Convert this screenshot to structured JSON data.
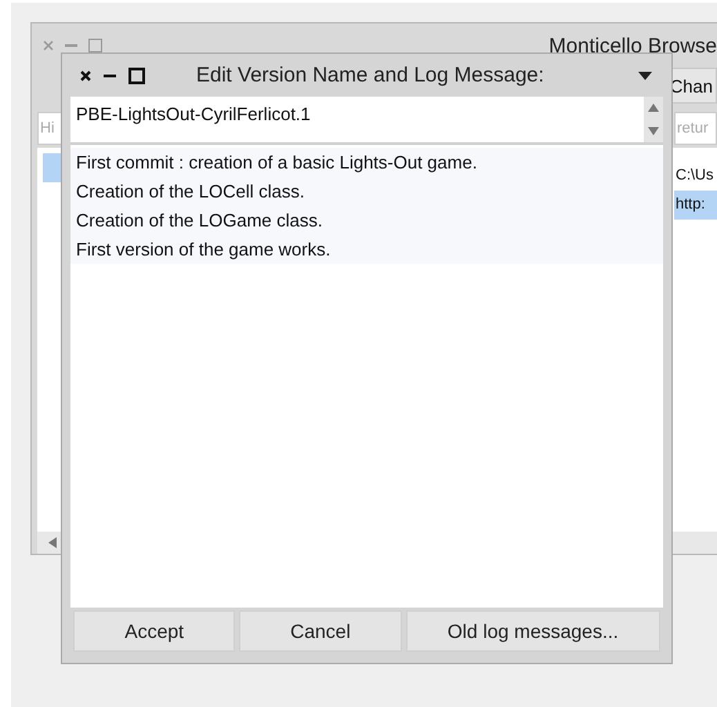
{
  "back_window": {
    "title": "Monticello Browse",
    "toolbar_button": "Chan",
    "search_left": {
      "placeholder": "Hi"
    },
    "search_right": {
      "placeholder": "retur"
    },
    "left_list": [
      {
        "selected": true
      }
    ],
    "right_list": [
      {
        "label": "C:\\Us",
        "selected": false
      },
      {
        "label": "http:",
        "selected": true
      }
    ]
  },
  "dialog": {
    "title": "Edit Version Name and Log Message:",
    "version_name": "PBE-LightsOut-CyrilFerlicot.1",
    "log_lines": [
      "First commit : creation of a basic Lights-Out game.",
      "Creation of the LOCell class.",
      "Creation of the LOGame class.",
      "First version of the game works."
    ],
    "buttons": [
      "Accept",
      "Cancel",
      "Old log messages..."
    ]
  }
}
